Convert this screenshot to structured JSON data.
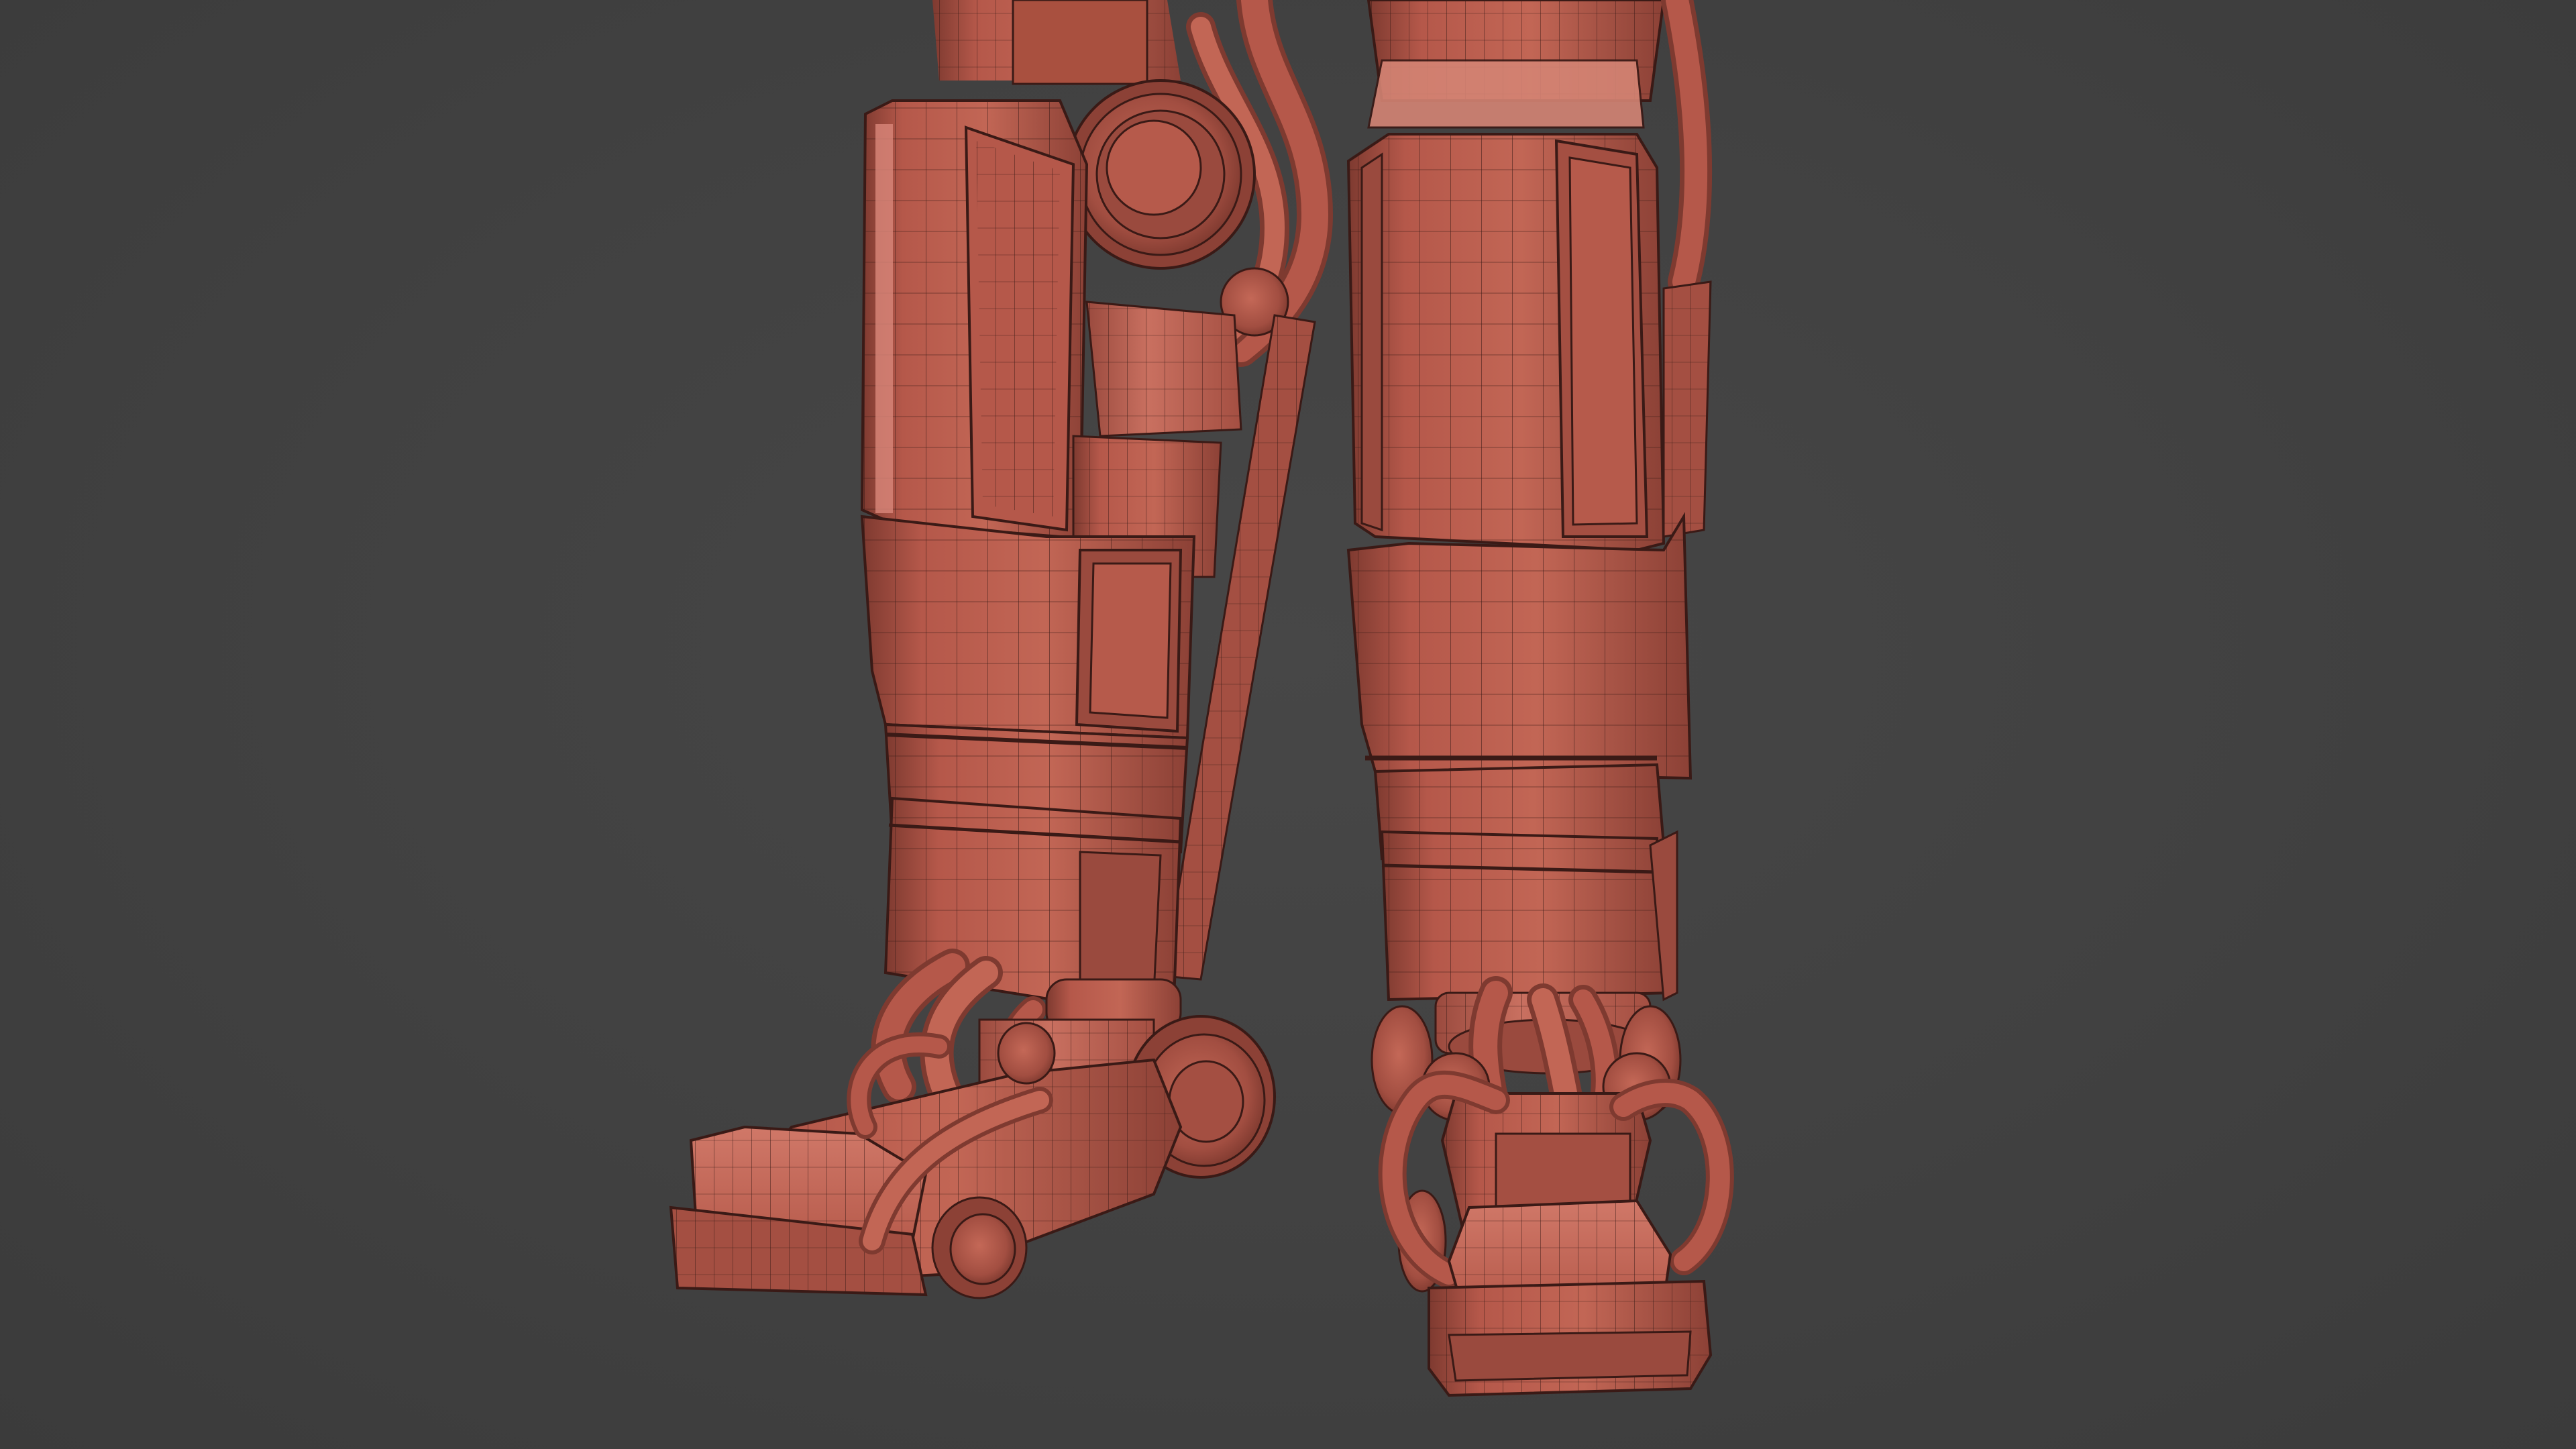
{
  "viewport": {
    "background_color": "#404040",
    "mesh_color": "#B5584A",
    "mesh_shadow_color": "#7E3A30",
    "mesh_highlight_color": "#D47A6A",
    "wire_color": "#3A1A16",
    "display_mode": "shaded-wireframe"
  },
  "scene": {
    "subject": "robot-legs",
    "parts": [
      "left-leg",
      "right-leg",
      "left-foot",
      "right-foot"
    ]
  }
}
